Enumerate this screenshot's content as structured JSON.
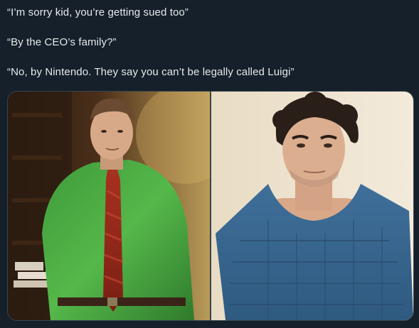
{
  "post": {
    "lines": [
      "“I’m sorry kid, you’re getting sued too”",
      "“By the CEO’s family?”",
      "“No, by Nintendo. They say you can’t be legally called Luigi”"
    ]
  },
  "media": {
    "left_image": "man-in-green-shirt-with-red-tie",
    "right_image": "young-man-in-blue-padded-vest-mugshot"
  },
  "colors": {
    "background": "#15202b",
    "text": "#e7e9ea",
    "border": "#38444d"
  }
}
